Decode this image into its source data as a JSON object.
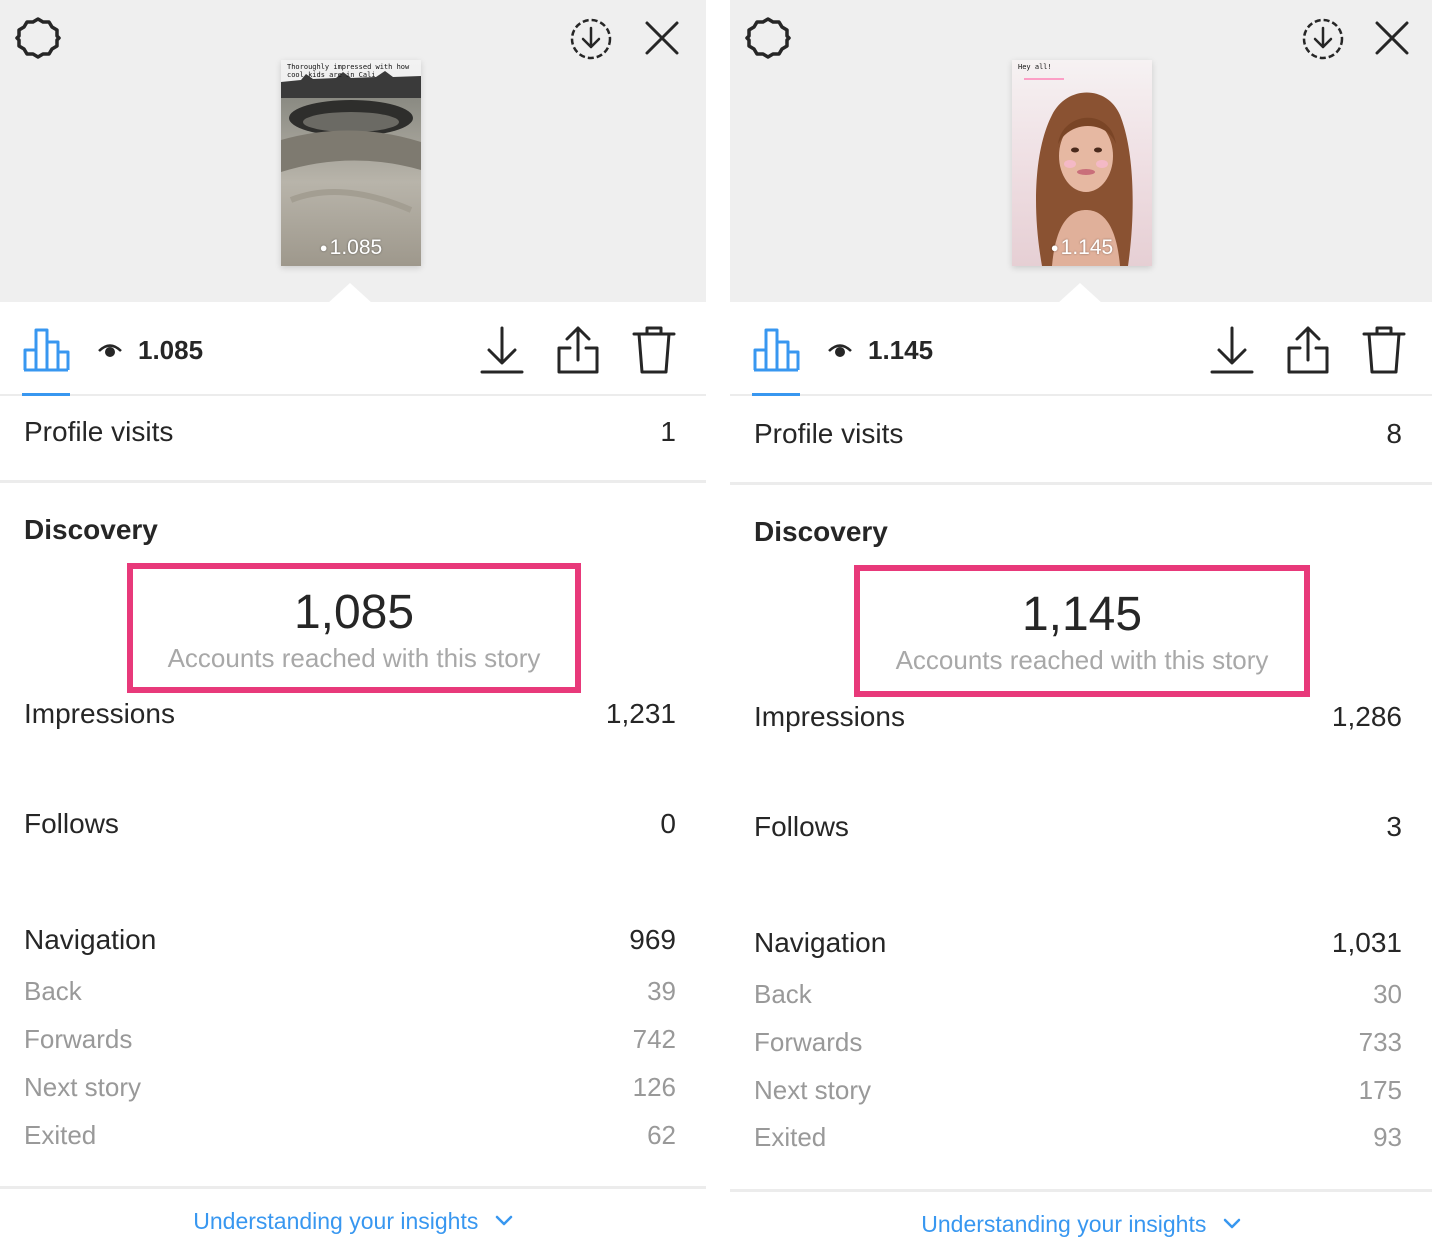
{
  "panels": [
    {
      "thumbnail": {
        "caption": "Thoroughly impressed with how cool kids are in Cali",
        "views": "1.085"
      },
      "toolbar": {
        "views": "1.085"
      },
      "profile_visits": {
        "label": "Profile visits",
        "value": "1"
      },
      "discovery": {
        "title": "Discovery",
        "reach_value": "1,085",
        "reach_label": "Accounts reached with this story",
        "impressions": {
          "label": "Impressions",
          "value": "1,231"
        },
        "follows": {
          "label": "Follows",
          "value": "0"
        }
      },
      "navigation": {
        "label": "Navigation",
        "value": "969",
        "items": [
          {
            "label": "Back",
            "value": "39"
          },
          {
            "label": "Forwards",
            "value": "742"
          },
          {
            "label": "Next story",
            "value": "126"
          },
          {
            "label": "Exited",
            "value": "62"
          }
        ]
      },
      "footer": {
        "link": "Understanding your insights"
      }
    },
    {
      "thumbnail": {
        "caption": "Hey all!",
        "views": "1.145"
      },
      "toolbar": {
        "views": "1.145"
      },
      "profile_visits": {
        "label": "Profile visits",
        "value": "8"
      },
      "discovery": {
        "title": "Discovery",
        "reach_value": "1,145",
        "reach_label": "Accounts reached with this story",
        "impressions": {
          "label": "Impressions",
          "value": "1,286"
        },
        "follows": {
          "label": "Follows",
          "value": "3"
        }
      },
      "navigation": {
        "label": "Navigation",
        "value": "1,031",
        "items": [
          {
            "label": "Back",
            "value": "30"
          },
          {
            "label": "Forwards",
            "value": "733"
          },
          {
            "label": "Next story",
            "value": "175"
          },
          {
            "label": "Exited",
            "value": "93"
          }
        ]
      },
      "footer": {
        "link": "Understanding your insights"
      }
    }
  ],
  "colors": {
    "accent_blue": "#3897f0",
    "highlight_pink": "#e8397a",
    "secondary_text": "#999999"
  },
  "icons": [
    "settings-icon",
    "download-circle-icon",
    "close-icon",
    "bar-chart-icon",
    "eye-icon",
    "download-icon",
    "share-icon",
    "trash-icon",
    "chevron-down-icon"
  ]
}
